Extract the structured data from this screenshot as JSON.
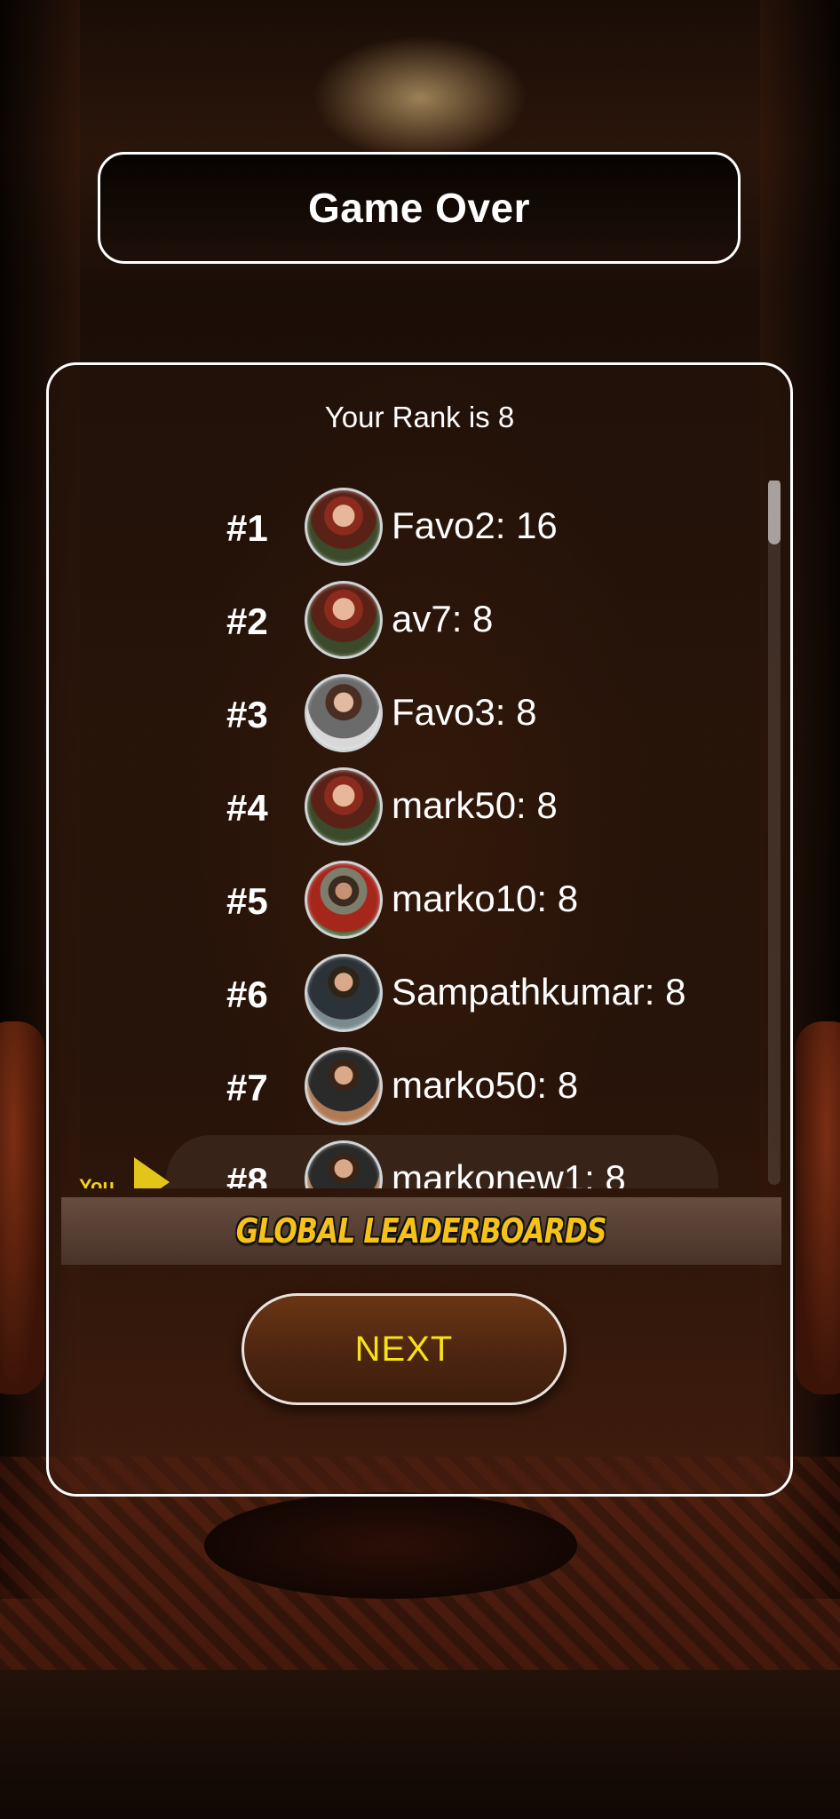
{
  "header": {
    "title": "Game Over"
  },
  "rank_message": "Your Rank is 8",
  "leaderboard": [
    {
      "position": "#1",
      "entry": "Favo2: 16",
      "avatar": "woman-red-beanie-avatar"
    },
    {
      "position": "#2",
      "entry": "av7: 8",
      "avatar": "woman-red-beanie-avatar"
    },
    {
      "position": "#3",
      "entry": "Favo3: 8",
      "avatar": "woman-grey-suit-avatar"
    },
    {
      "position": "#4",
      "entry": "mark50: 8",
      "avatar": "woman-red-beanie-avatar"
    },
    {
      "position": "#5",
      "entry": "marko10: 8",
      "avatar": "bearded-man-beanie-avatar"
    },
    {
      "position": "#6",
      "entry": "Sampathkumar: 8",
      "avatar": "man-dark-suit-avatar"
    },
    {
      "position": "#7",
      "entry": "marko50: 8",
      "avatar": "man-brown-suit-avatar"
    },
    {
      "position": "#8",
      "entry": "markonew1: 8",
      "avatar": "man-brown-suit-avatar"
    }
  ],
  "current_user": {
    "label": "You"
  },
  "global_leaderboards_label": "GLOBAL LEADERBOARDS",
  "next_button_label": "NEXT",
  "colors": {
    "accent_yellow": "#f6e21a",
    "leaderboard_title_yellow": "#f6c21a",
    "panel_border": "#ffffff"
  }
}
